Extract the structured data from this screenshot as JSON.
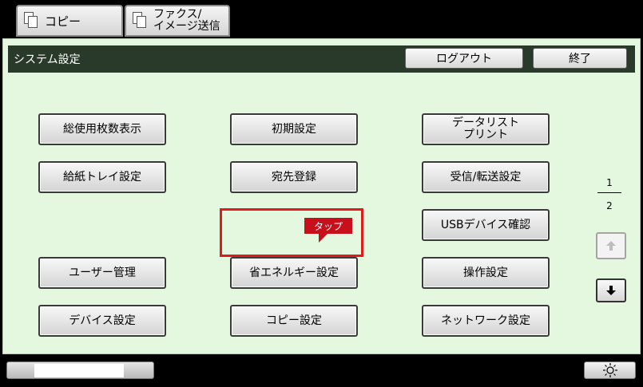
{
  "tabs": [
    {
      "label": "コピー"
    },
    {
      "label": "ファクス/\nイメージ送信"
    }
  ],
  "header": {
    "title": "システム設定",
    "logout_label": "ログアウト",
    "exit_label": "終了"
  },
  "menu": {
    "col1": [
      "総使用枚数表示",
      "給紙トレイ設定",
      "ユーザー管理",
      "デバイス設定"
    ],
    "col2": [
      "初期設定",
      "宛先登録",
      "省エネルギー設定",
      "コピー設定"
    ],
    "col3": [
      "データリスト\nプリント",
      "受信/転送設定",
      "USBデバイス確認",
      "操作設定",
      "ネットワーク設定"
    ]
  },
  "annotation": {
    "tap_label": "タップ",
    "color": "#e01b1b"
  },
  "pager": {
    "current": "1",
    "total": "2"
  },
  "icons": {
    "copy_tab": "copy-pages-icon",
    "fax_tab": "fax-pages-icon",
    "up": "arrow-up-icon",
    "down": "arrow-down-icon",
    "brightness": "brightness-icon"
  }
}
